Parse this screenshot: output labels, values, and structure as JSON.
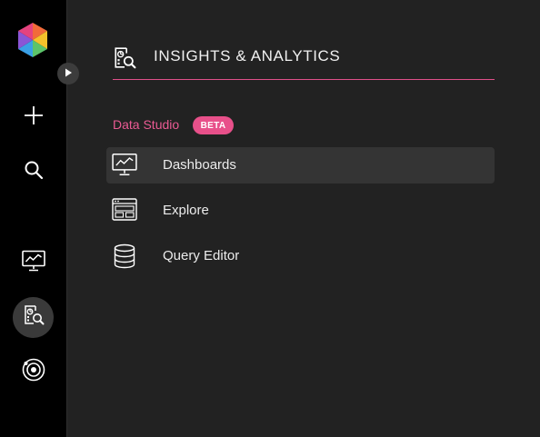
{
  "rail": {
    "items": [
      {
        "icon": "plus-icon"
      },
      {
        "icon": "search-icon"
      },
      {
        "icon": "dashboard-monitor-icon"
      },
      {
        "icon": "insights-analytics-icon",
        "active": true
      },
      {
        "icon": "orbit-icon"
      }
    ]
  },
  "panel": {
    "title": "INSIGHTS & ANALYTICS",
    "section_label": "Data Studio",
    "badge": "BETA",
    "items": [
      {
        "label": "Dashboards",
        "icon": "dashboard-monitor-icon",
        "active": true
      },
      {
        "label": "Explore",
        "icon": "explore-window-icon"
      },
      {
        "label": "Query Editor",
        "icon": "database-icon"
      }
    ]
  },
  "colors": {
    "accent": "#e8508a",
    "rail_bg": "#000000",
    "panel_bg": "#222222"
  }
}
